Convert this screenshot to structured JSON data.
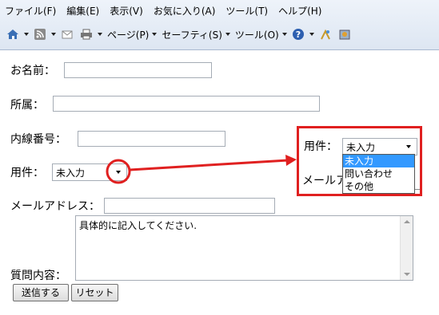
{
  "menu": [
    "ファイル(F)",
    "編集(E)",
    "表示(V)",
    "お気に入り(A)",
    "ツール(T)",
    "ヘルプ(H)"
  ],
  "toolbar": {
    "home_icon": "home-icon",
    "feeds_icon": "rss-icon",
    "mail_icon": "mail-icon",
    "print_icon": "printer-icon",
    "page_label": "ページ(P)",
    "safety_label": "セーフティ(S)",
    "tools_label": "ツール(O)",
    "help_icon": "help-icon",
    "research_icon": "research-icon",
    "addon_icon": "addon-icon"
  },
  "form": {
    "name_label": "お名前：",
    "dept_label": "所属：",
    "ext_label": "内線番号：",
    "subject_label": "用件：",
    "subject_value": "未入力",
    "email_label": "メールアドレス：",
    "question_label": "質問内容：",
    "question_value": "具体的に記入してください.",
    "submit_label": "送信する",
    "reset_label": "リセット"
  },
  "callout": {
    "subject_label": "用件：",
    "subject_value": "未入力",
    "email_label_partial": "メールア",
    "options": [
      "未入力",
      "問い合わせ",
      "その他"
    ],
    "selected_index": 0,
    "color": "#e02020"
  }
}
